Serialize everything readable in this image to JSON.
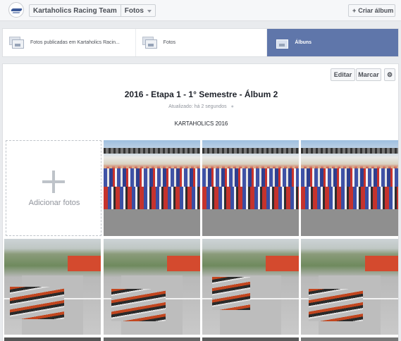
{
  "header": {
    "page_name": "Kartaholics Racing Team",
    "section": "Fotos",
    "create_album_label": "Criar álbum"
  },
  "tabs": [
    {
      "label": "Fotos publicadas em Kartaholics Racin...",
      "active": false
    },
    {
      "label": "Fotos",
      "active": false
    },
    {
      "label": "Álbuns",
      "active": true
    }
  ],
  "album": {
    "edit_label": "Editar",
    "tag_label": "Marcar",
    "title": "2016 - Etapa 1 - 1° Semestre - Álbum 2",
    "updated": "Atualizado: há 2 segundos",
    "description": "KARTAHOLICS 2016",
    "add_photos_label": "Adicionar fotos"
  },
  "colors": {
    "active_tab": "#5f76aa",
    "brand": "#3b5998"
  },
  "icons": [
    "page-avatar",
    "chevron-down-icon",
    "plus-icon",
    "photos-tab-icon",
    "albums-tab-icon",
    "gear-icon",
    "globe-icon"
  ]
}
